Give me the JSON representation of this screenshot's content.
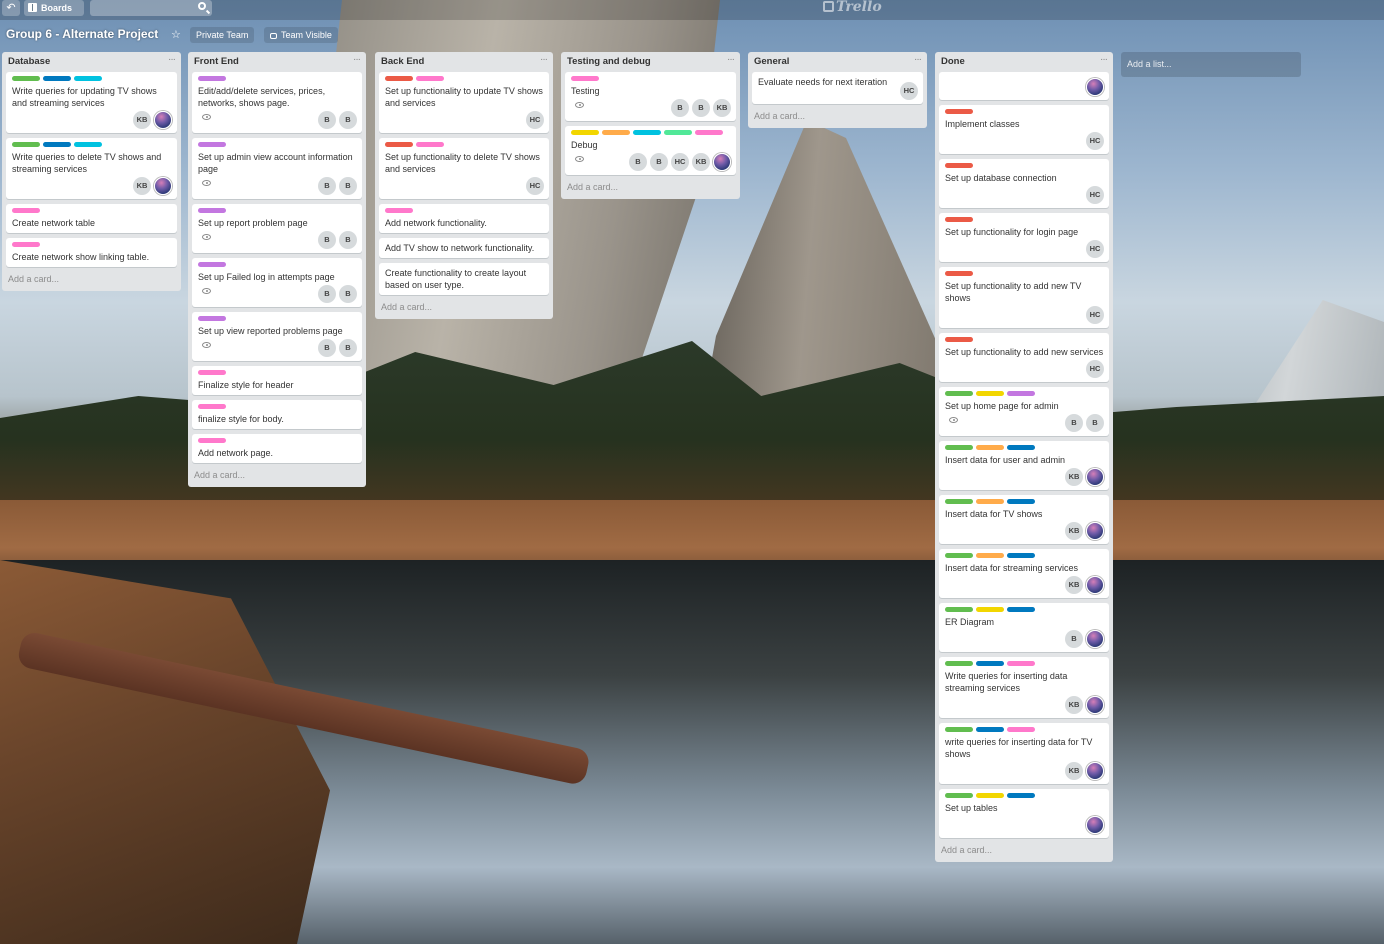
{
  "header": {
    "boards_label": "Boards",
    "logo_text": "Trello"
  },
  "board": {
    "title": "Group 6 - Alternate Project",
    "team_label": "Private Team",
    "visibility_label": "Team Visible"
  },
  "colors": {
    "green": "#61bd4f",
    "blue": "#0079bf",
    "sky": "#00c2e0",
    "pink": "#ff78cb",
    "purple": "#c377e0",
    "red": "#eb5a46",
    "yellow": "#f2d600",
    "orange": "#ffab4a",
    "lime": "#51e898"
  },
  "add_list_label": "Add a list...",
  "lists": [
    {
      "title": "Database",
      "add_card": "Add a card...",
      "cards": [
        {
          "labels": [
            "green",
            "blue",
            "sky"
          ],
          "title": "Write queries for updating TV shows and streaming services",
          "eye": false,
          "members": [
            "KB",
            "photo"
          ]
        },
        {
          "labels": [
            "green",
            "blue",
            "sky"
          ],
          "title": "Write queries to delete TV shows and streaming services",
          "eye": false,
          "members": [
            "KB",
            "photo"
          ]
        },
        {
          "labels": [
            "pink"
          ],
          "title": "Create network table",
          "eye": false,
          "members": []
        },
        {
          "labels": [
            "pink"
          ],
          "title": "Create network show linking table.",
          "eye": false,
          "members": []
        }
      ]
    },
    {
      "title": "Front End",
      "add_card": "Add a card...",
      "cards": [
        {
          "labels": [
            "purple"
          ],
          "title": "Edit/add/delete services, prices, networks, shows page.",
          "eye": true,
          "members": [
            "B",
            "B"
          ]
        },
        {
          "labels": [
            "purple"
          ],
          "title": "Set up admin view account information page",
          "eye": true,
          "members": [
            "B",
            "B"
          ]
        },
        {
          "labels": [
            "purple"
          ],
          "title": "Set up report problem page",
          "eye": true,
          "members": [
            "B",
            "B"
          ]
        },
        {
          "labels": [
            "purple"
          ],
          "title": "Set up Failed log in attempts page",
          "eye": true,
          "members": [
            "B",
            "B"
          ]
        },
        {
          "labels": [
            "purple"
          ],
          "title": "Set up view reported problems page",
          "eye": true,
          "members": [
            "B",
            "B"
          ]
        },
        {
          "labels": [
            "pink"
          ],
          "title": "Finalize style for header",
          "eye": false,
          "members": []
        },
        {
          "labels": [
            "pink"
          ],
          "title": "finalize style for body.",
          "eye": false,
          "members": []
        },
        {
          "labels": [
            "pink"
          ],
          "title": "Add network page.",
          "eye": false,
          "members": []
        }
      ]
    },
    {
      "title": "Back End",
      "add_card": "Add a card...",
      "cards": [
        {
          "labels": [
            "red",
            "pink"
          ],
          "title": "Set up functionality to update TV shows and services",
          "eye": false,
          "members": [
            "HC"
          ]
        },
        {
          "labels": [
            "red",
            "pink"
          ],
          "title": "Set up functionality to delete TV shows and services",
          "eye": false,
          "members": [
            "HC"
          ]
        },
        {
          "labels": [
            "pink"
          ],
          "title": "Add network functionality.",
          "eye": false,
          "members": []
        },
        {
          "labels": [],
          "title": "Add TV show to network functionality.",
          "eye": false,
          "members": []
        },
        {
          "labels": [],
          "title": "Create functionality to create layout based on user type.",
          "eye": false,
          "members": []
        }
      ]
    },
    {
      "title": "Testing and debug",
      "add_card": "Add a card...",
      "cards": [
        {
          "labels": [
            "pink"
          ],
          "title": "Testing",
          "eye": true,
          "members": [
            "B",
            "B",
            "KB"
          ]
        },
        {
          "labels": [
            "yellow",
            "orange",
            "sky",
            "lime",
            "pink"
          ],
          "title": "Debug",
          "eye": true,
          "members": [
            "B",
            "B",
            "HC",
            "KB",
            "photo"
          ]
        }
      ]
    },
    {
      "title": "General",
      "add_card": "Add a card...",
      "cards": [
        {
          "labels": [],
          "title": "Evaluate needs for next iteration",
          "eye": false,
          "members": [
            "HC"
          ],
          "inline_members": true
        }
      ]
    },
    {
      "title": "Done",
      "add_card": "Add a card...",
      "cards": [
        {
          "labels": [],
          "title": "",
          "eye": false,
          "members": [
            "photo"
          ],
          "inline_members": true
        },
        {
          "labels": [
            "red"
          ],
          "title": "Implement classes",
          "eye": false,
          "members": [
            "HC"
          ]
        },
        {
          "labels": [
            "red"
          ],
          "title": "Set up database connection",
          "eye": false,
          "members": [
            "HC"
          ]
        },
        {
          "labels": [
            "red"
          ],
          "title": "Set up functionality for login page",
          "eye": false,
          "members": [
            "HC"
          ]
        },
        {
          "labels": [
            "red"
          ],
          "title": "Set up functionality to add new TV shows",
          "eye": false,
          "members": [
            "HC"
          ]
        },
        {
          "labels": [
            "red"
          ],
          "title": "Set up functionality to add new services",
          "eye": false,
          "members": [
            "HC"
          ]
        },
        {
          "labels": [
            "green",
            "yellow",
            "purple"
          ],
          "title": "Set up home page for admin",
          "eye": true,
          "members": [
            "B",
            "B"
          ]
        },
        {
          "labels": [
            "green",
            "orange",
            "blue"
          ],
          "title": "Insert data for user and admin",
          "eye": false,
          "members": [
            "KB",
            "photo"
          ]
        },
        {
          "labels": [
            "green",
            "orange",
            "blue"
          ],
          "title": "Insert data for TV shows",
          "eye": false,
          "members": [
            "KB",
            "photo"
          ]
        },
        {
          "labels": [
            "green",
            "orange",
            "blue"
          ],
          "title": "Insert data for streaming services",
          "eye": false,
          "members": [
            "KB",
            "photo"
          ]
        },
        {
          "labels": [
            "green",
            "yellow",
            "blue"
          ],
          "title": "ER Diagram",
          "eye": false,
          "members": [
            "B",
            "photo"
          ]
        },
        {
          "labels": [
            "green",
            "blue",
            "pink"
          ],
          "title": "Write queries for inserting data streaming services",
          "eye": false,
          "members": [
            "KB",
            "photo"
          ]
        },
        {
          "labels": [
            "green",
            "blue",
            "pink"
          ],
          "title": "write queries for inserting data for TV shows",
          "eye": false,
          "members": [
            "KB",
            "photo"
          ]
        },
        {
          "labels": [
            "green",
            "yellow",
            "blue"
          ],
          "title": "Set up tables",
          "eye": false,
          "members": [
            "photo"
          ]
        }
      ]
    }
  ]
}
